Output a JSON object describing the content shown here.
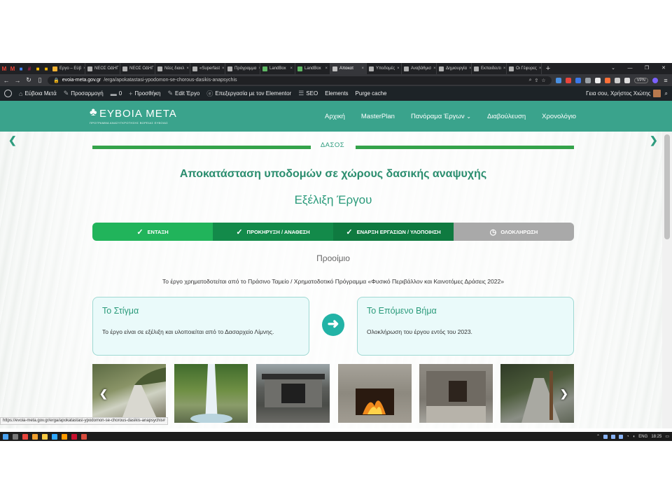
{
  "browser": {
    "tabs": [
      {
        "label": "Εργο – Εύβ",
        "color": "#f2b233"
      },
      {
        "label": "ΝΕΟΣ ΟΔΗΓ",
        "color": "#b0b0b0"
      },
      {
        "label": "ΝΕΟΣ ΟΔΗΓ",
        "color": "#b0b0b0"
      },
      {
        "label": "Νέες διακλ",
        "color": "#b0b0b0"
      },
      {
        "label": "«Superfast",
        "color": "#b0b0b0"
      },
      {
        "label": "Πρόγραμμα",
        "color": "#b0b0b0"
      },
      {
        "label": "LandBox",
        "color": "#5fb865"
      },
      {
        "label": "LandBox",
        "color": "#5fb865"
      },
      {
        "label": "Αποκατ",
        "color": "#c0c0c0",
        "active": true
      },
      {
        "label": "Υποδομές",
        "color": "#b0b0b0"
      },
      {
        "label": "Αναβάθμισ",
        "color": "#b0b0b0"
      },
      {
        "label": "Δημιουργία",
        "color": "#b0b0b0"
      },
      {
        "label": "Εκπαιδευτι",
        "color": "#b0b0b0"
      },
      {
        "label": "Οι Γέφυρες",
        "color": "#b0b0b0"
      }
    ],
    "url_host": "evoia-meta.gov.gr",
    "url_path": "/erga/apokatastasi-ypodomon-se-chorous-dasikis-anapsychis",
    "vpn_label": "VPN"
  },
  "wp_admin_bar": {
    "site_name": "Εύβοια Μετά",
    "customize": "Προσαρμογή",
    "comments_count": "0",
    "new": "Προσθήκη",
    "edit": "Edit Έργο",
    "elementor": "Επεξεργασία με τον Elementor",
    "seo": "SEO",
    "elements": "Elements",
    "purge": "Purge cache",
    "greeting": "Γεια σου, Χρήστος Χιώτης"
  },
  "site": {
    "logo_title": "ΕΥΒΟΙΑ ΜΕΤΑ",
    "logo_subtitle": "ΠΡΟΓΡΑΜΜΑ ΑΝΑΣΥΓΚΡΟΤΗΣΗΣ ΒΟΡΕΙΑΣ ΕΥΒΟΙΑΣ",
    "menu": [
      "Αρχική",
      "MasterPlan",
      "Πανόραμα Έργων",
      "Διαβούλευση",
      "Χρονολόγιο"
    ]
  },
  "project": {
    "section_label": "ΔΑΣΟΣ",
    "title": "Αποκατάσταση υποδομών σε χώρους δασικής αναψυχής",
    "progress_title": "Εξέλιξη Έργου",
    "steps": [
      {
        "label": "ΕΝΤΑΞΗ",
        "status": "done"
      },
      {
        "label": "ΠΡΟΚΗΡΥΞΗ / ΑΝΑΘΕΣΗ",
        "status": "done"
      },
      {
        "label": "ΕΝΑΡΞΗ ΕΡΓΑΣΙΩΝ / ΥΛΟΠΟΙΗΣΗ",
        "status": "done"
      },
      {
        "label": "ΟΛΟΚΛΗΡΩΣΗ",
        "status": "pending"
      }
    ],
    "intro_heading": "Προοίμιο",
    "funding_text": "Το έργο χρηματοδοτείται από το Πράσινο Ταμείο / Χρηματοδοτικό Πρόγραμμα «Φυσικό Περιβάλλον και Καινοτόμες Δράσεις 2022»",
    "current": {
      "heading": "Το Στίγμα",
      "text": "Το έργο είναι σε εξέλιξη και υλοποιείται από το Δασαρχείο Λίμνης."
    },
    "next": {
      "heading": "Το Επόμενο Βήμα",
      "text": "Ολοκλήρωση του έργου εντός του 2023."
    }
  },
  "status_bar_url": "https://evoia-meta.gov.gr/erga/apokatastasi-ypodomon-se-chorous-dasikis-anapsychis#",
  "taskbar": {
    "lang": "ENG",
    "time": "18:25"
  },
  "colors": {
    "brand": "#3aa38c",
    "accent_green": "#34a34a",
    "step_pending": "#a9a9a9"
  }
}
